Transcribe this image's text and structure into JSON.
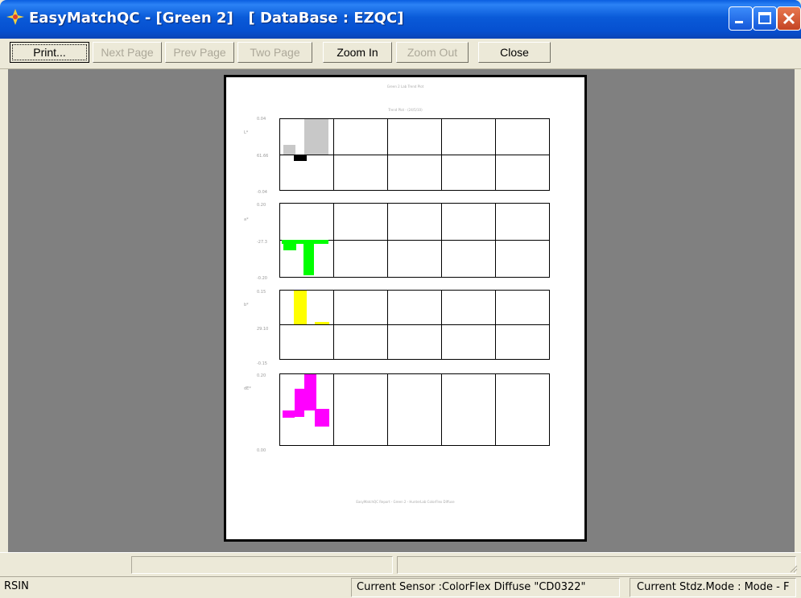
{
  "window": {
    "title": "EasyMatchQC - [Green 2]   [ DataBase : EZQC]",
    "icon": "easymatch-app-icon",
    "controls": [
      "minimize-icon",
      "maximize-icon",
      "close-icon"
    ]
  },
  "toolbar": {
    "print": "Print...",
    "next_page": "Next Page",
    "prev_page": "Prev Page",
    "two_page": "Two Page",
    "zoom_in": "Zoom In",
    "zoom_out": "Zoom Out",
    "close": "Close"
  },
  "page": {
    "header": "Green 2 Lab Trend Plot",
    "chart_title": "Trend Plot - (24/5/10)",
    "footer": "EasyMatchQC Report - Green 2 - HunterLab ColorFlex Diffuse"
  },
  "panels": [
    {
      "label": "L*",
      "top": "0.04",
      "mid": "61.66",
      "bottom": "-0.04",
      "color": "#c8c8c8",
      "accent": "#000000"
    },
    {
      "label": "a*",
      "top": "0.20",
      "mid": "-27.3",
      "bottom": "-0.20",
      "color": "#00ff00"
    },
    {
      "label": "b*",
      "top": "0.15",
      "mid": "29.10",
      "bottom": "-0.15",
      "color": "#ffff00"
    },
    {
      "label": "dE*",
      "top": "0.20",
      "mid": "",
      "bottom": "0.00",
      "color": "#ff00ff"
    }
  ],
  "status": {
    "left": "RSIN",
    "sensor": "Current Sensor :ColorFlex Diffuse \"CD0322\"",
    "stdz_mode": "Current Stdz.Mode :  Mode - F"
  }
}
